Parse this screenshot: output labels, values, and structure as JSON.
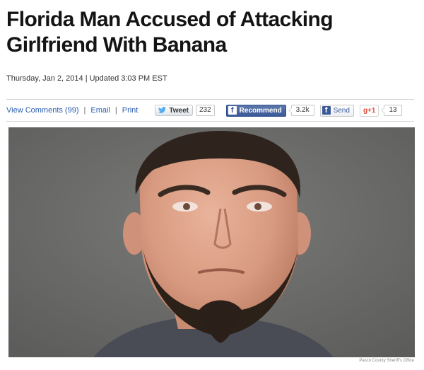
{
  "article": {
    "headline": "Florida Man Accused of Attacking Girlfriend With Banana",
    "dateline": "Thursday, Jan 2, 2014 | Updated 3:03 PM EST"
  },
  "toolbar": {
    "view_comments": "View Comments (99)",
    "email": "Email",
    "print": "Print",
    "separator": "|"
  },
  "social": {
    "tweet_label": "Tweet",
    "tweet_count": "232",
    "fb_f": "f",
    "recommend_label": "Recommend",
    "recommend_count": "3.2k",
    "send_label": "Send",
    "gplus_label": "g+1",
    "gplus_count": "13"
  },
  "photo": {
    "credit": "Pasco County Sheriff's Office"
  },
  "colors": {
    "link": "#2a5db0",
    "facebook": "#3b5998",
    "google_plus": "#dd4b39",
    "twitter": "#55acee"
  }
}
